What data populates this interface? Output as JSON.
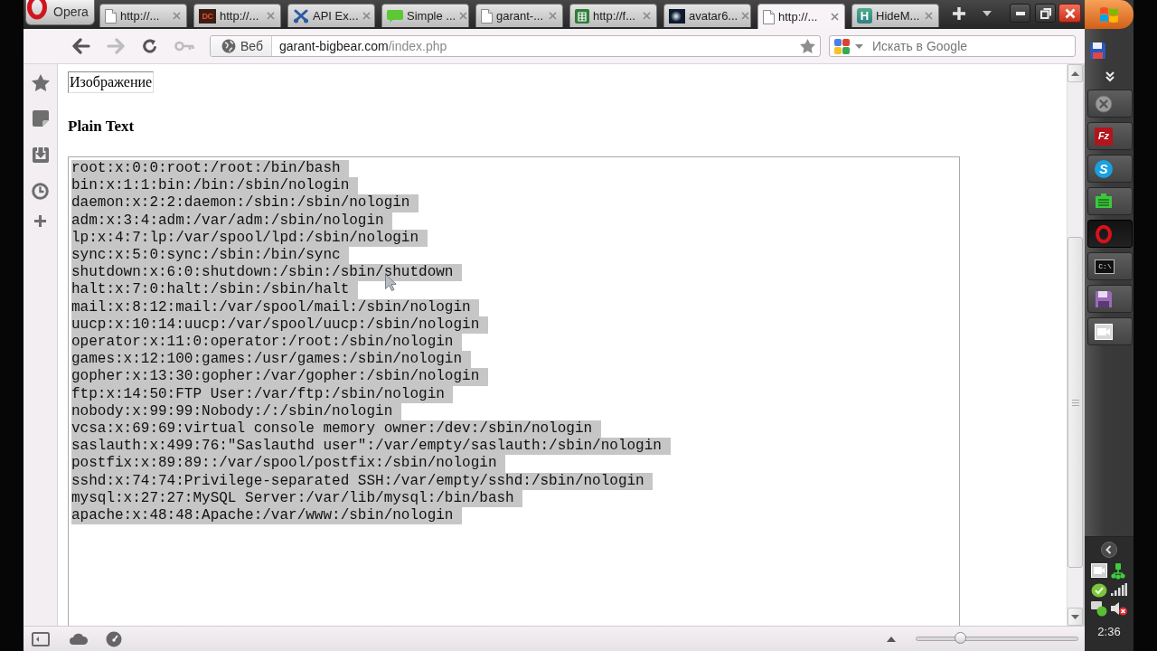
{
  "browser": {
    "menu_button": {
      "label": "Opera"
    },
    "tabs": [
      {
        "title": "http://...",
        "kind": "page",
        "selected": false
      },
      {
        "title": "http://...",
        "kind": "dc",
        "logo_text": "DC",
        "selected": false
      },
      {
        "title": "API Ex...",
        "kind": "tools",
        "selected": false
      },
      {
        "title": "Simple ...",
        "kind": "chat",
        "selected": false
      },
      {
        "title": "garant-...",
        "kind": "page",
        "selected": false
      },
      {
        "title": "http://f...",
        "kind": "sheet",
        "selected": false
      },
      {
        "title": "avatar6...",
        "kind": "image",
        "selected": false
      },
      {
        "title": "http://...",
        "kind": "page",
        "selected": true
      },
      {
        "title": "HideM...",
        "kind": "tile",
        "logo_text": "H",
        "selected": false
      }
    ],
    "nav_buttons": [
      {
        "kind": "back",
        "disabled": false
      },
      {
        "kind": "forward",
        "disabled": true
      },
      {
        "kind": "reload",
        "disabled": false
      },
      {
        "kind": "wand",
        "disabled": true
      }
    ],
    "address_field": {
      "badge": "Веб",
      "host": "garant-bigbear.com",
      "path": "/index.php"
    },
    "search_field": {
      "placeholder": "Искать в Google"
    }
  },
  "page": {
    "image_alt": "Изображение",
    "heading": "Plain Text",
    "textarea": {
      "text_selected": true,
      "lines": [
        "root:x:0:0:root:/root:/bin/bash",
        "bin:x:1:1:bin:/bin:/sbin/nologin",
        "daemon:x:2:2:daemon:/sbin:/sbin/nologin",
        "adm:x:3:4:adm:/var/adm:/sbin/nologin",
        "lp:x:4:7:lp:/var/spool/lpd:/sbin/nologin",
        "sync:x:5:0:sync:/sbin:/bin/sync",
        "shutdown:x:6:0:shutdown:/sbin:/sbin/shutdown",
        "halt:x:7:0:halt:/sbin:/sbin/halt",
        "mail:x:8:12:mail:/var/spool/mail:/sbin/nologin",
        "uucp:x:10:14:uucp:/var/spool/uucp:/sbin/nologin",
        "operator:x:11:0:operator:/root:/sbin/nologin",
        "games:x:12:100:games:/usr/games:/sbin/nologin",
        "gopher:x:13:30:gopher:/var/gopher:/sbin/nologin",
        "ftp:x:14:50:FTP User:/var/ftp:/sbin/nologin",
        "nobody:x:99:99:Nobody:/:/sbin/nologin",
        "vcsa:x:69:69:virtual console memory owner:/dev:/sbin/nologin",
        "saslauth:x:499:76:\"Saslauthd user\":/var/empty/saslauth:/sbin/nologin",
        "postfix:x:89:89::/var/spool/postfix:/sbin/nologin",
        "sshd:x:74:74:Privilege-separated SSH:/var/empty/sshd:/sbin/nologin",
        "mysql:x:27:27:MySQL Server:/var/lib/mysql:/bin/bash",
        "apache:x:48:48:Apache:/var/www:/sbin/nologin"
      ]
    }
  },
  "status_bar": {
    "zoom_slider": {
      "level": 0.27
    }
  },
  "taskbar": {
    "tasks": [
      {
        "kind": "blocked",
        "selected": false
      },
      {
        "kind": "ftp",
        "logo_text": "Fz",
        "selected": false
      },
      {
        "kind": "phone",
        "logo_text": "S",
        "selected": false
      },
      {
        "kind": "card",
        "selected": false
      },
      {
        "kind": "ring",
        "selected": true
      },
      {
        "kind": "console",
        "logo_text": "C:\\",
        "selected": false
      },
      {
        "kind": "disk",
        "selected": false
      },
      {
        "kind": "video",
        "selected": false
      }
    ],
    "clock": "2:36"
  }
}
